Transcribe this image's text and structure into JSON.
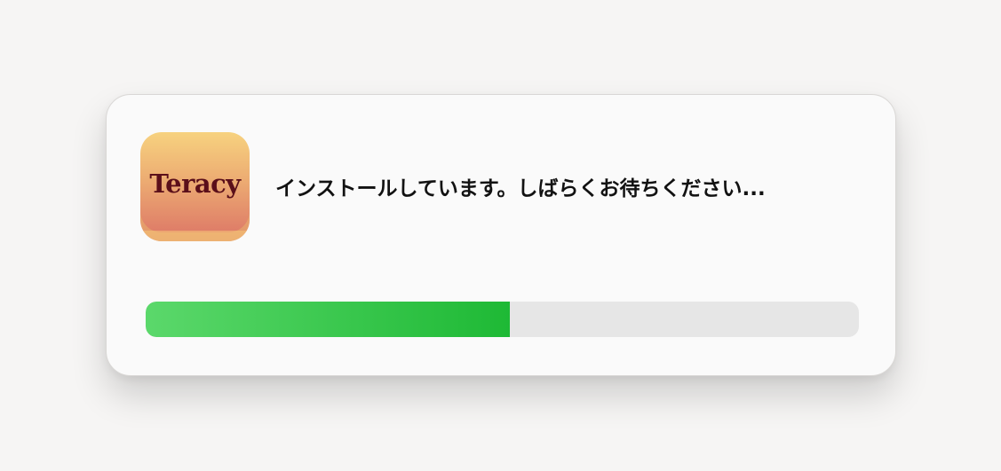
{
  "dialog": {
    "app_name": "Teracy",
    "status_text": "インストールしています。しばらくお待ちください...",
    "progress": {
      "value": 0.51,
      "fill_color_start": "#5bd86b",
      "fill_color_end": "#1eb935",
      "track_color": "#e6e6e6"
    },
    "icon": "teracy-app-icon"
  }
}
